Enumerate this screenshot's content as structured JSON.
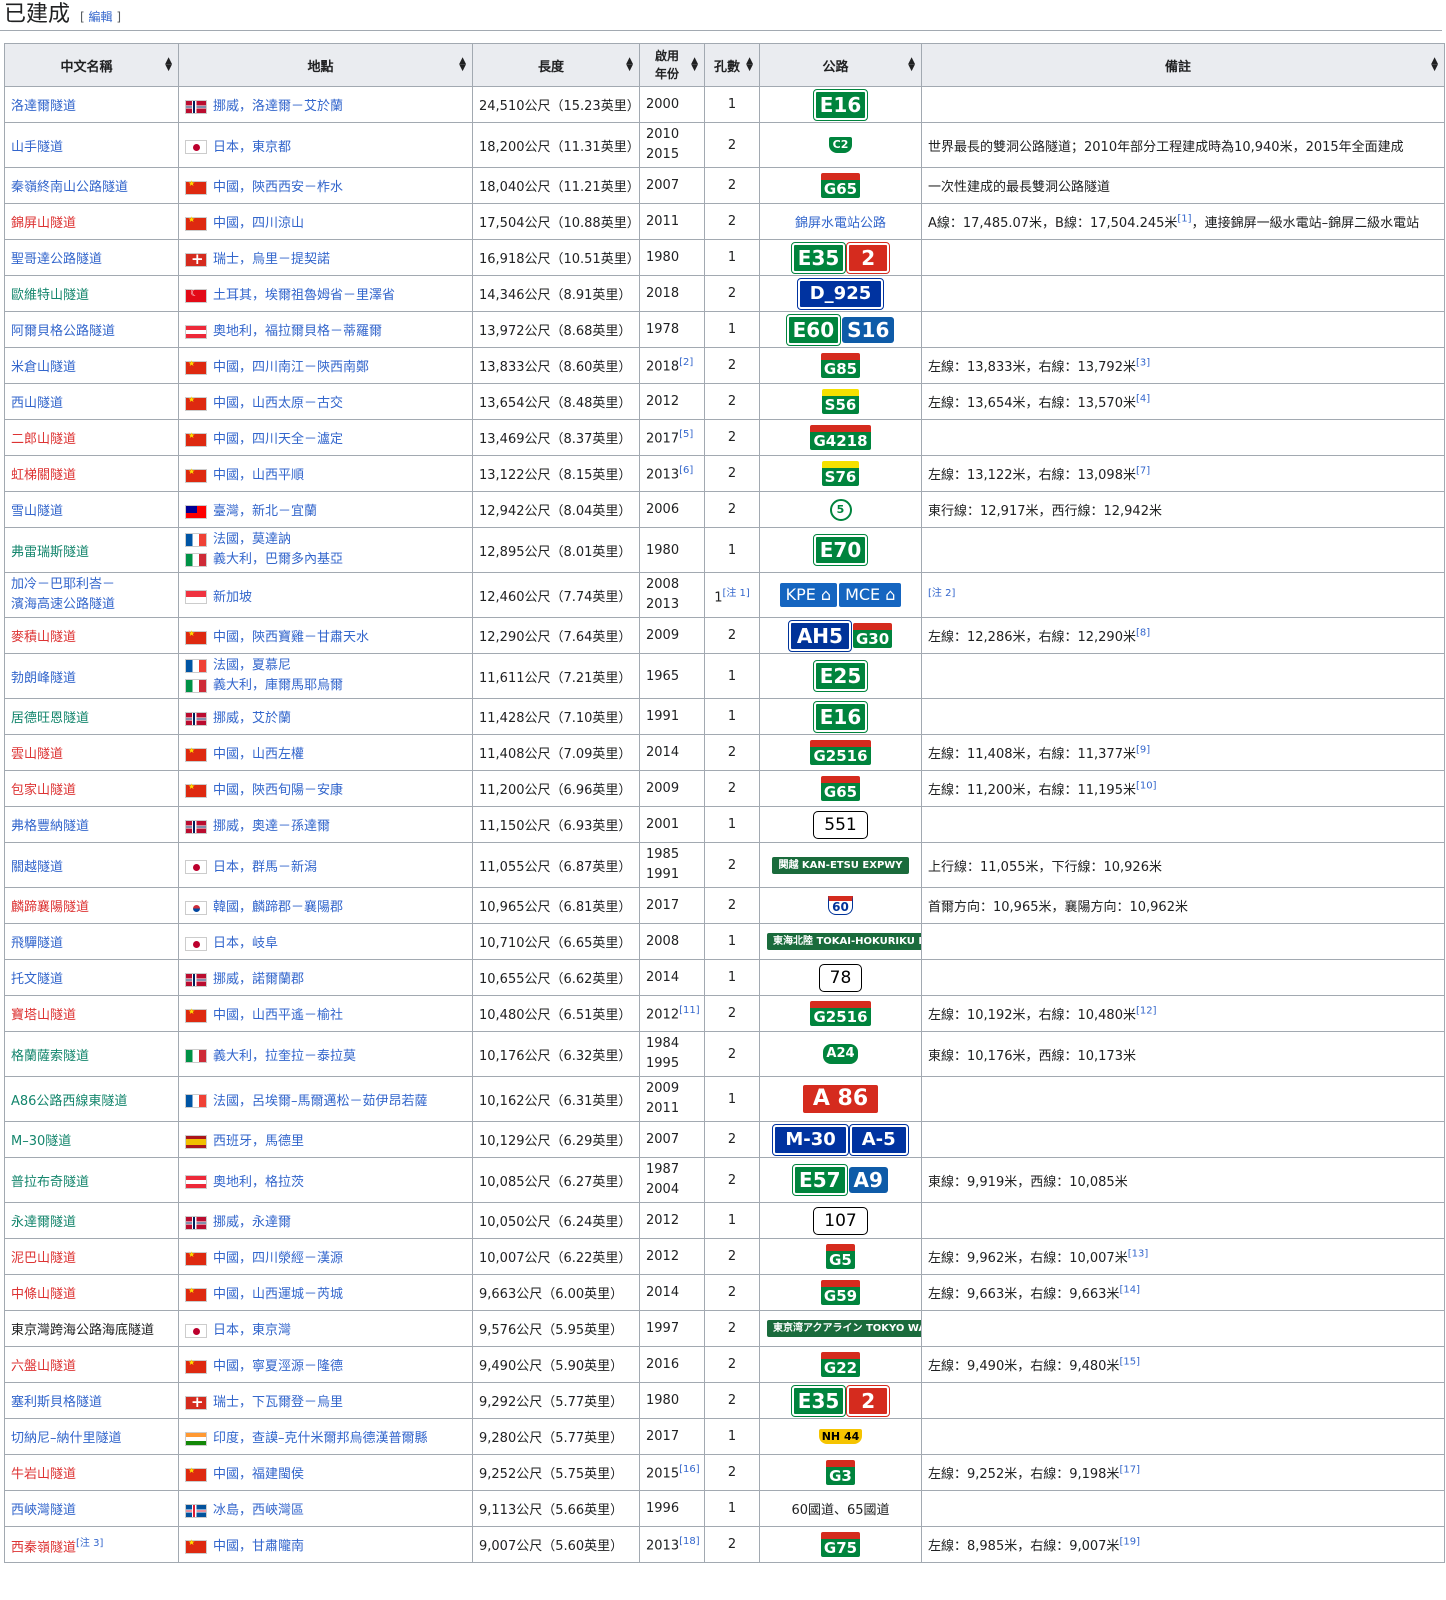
{
  "section": {
    "title": "已建成",
    "edit_open": "[",
    "edit_label": "編輯",
    "edit_close": "]"
  },
  "headers": {
    "name": "中文名稱",
    "location": "地點",
    "length": "長度",
    "year_line1": "啟用",
    "year_line2": "年份",
    "bores": "孔數",
    "road": "公路",
    "notes": "備註"
  },
  "rows": [
    {
      "name": "洛達爾隧道",
      "nc": "lk",
      "flag": "no",
      "loc": "挪威，洛達爾－艾於蘭",
      "len": "24,510公尺（15.23英里）",
      "y1": "2000",
      "y2": "",
      "ysup": "",
      "bores": "1",
      "bsup": "",
      "roads": [
        {
          "t": "E16",
          "k": "r-e"
        }
      ],
      "note": "",
      "nsup": ""
    },
    {
      "name": "山手隧道",
      "nc": "lk",
      "flag": "jp",
      "loc": "日本，東京都",
      "len": "18,200公尺（11.31英里）",
      "y1": "2010",
      "y2": "2015",
      "ysup": "",
      "bores": "2",
      "bsup": "",
      "roads": [
        {
          "t": "C2",
          "k": "r-c2"
        }
      ],
      "note": "世界最長的雙洞公路隧道；2010年部分工程建成時為10,940米，2015年全面建成",
      "nsup": ""
    },
    {
      "name": "秦嶺終南山公路隧道",
      "nc": "lk",
      "flag": "cn",
      "loc": "中國，陝西西安－柞水",
      "len": "18,040公尺（11.21英里）",
      "y1": "2007",
      "y2": "",
      "ysup": "",
      "bores": "2",
      "bsup": "",
      "roads": [
        {
          "t": "G65",
          "k": "r-g"
        }
      ],
      "note": "一次性建成的最長雙洞公路隧道",
      "nsup": ""
    },
    {
      "name": "錦屏山隧道",
      "nc": "lk-r",
      "flag": "cn",
      "loc": "中國，四川涼山",
      "len": "17,504公尺（10.88英里）",
      "y1": "2011",
      "y2": "",
      "ysup": "",
      "bores": "2",
      "bsup": "",
      "roads": [
        {
          "t": "錦屏水電站公路",
          "k": "text"
        }
      ],
      "note": "A線：17,485.07米，B線：17,504.245米",
      "nsup": "[1]",
      "note2": "，連接錦屏一級水電站–錦屏二級水電站"
    },
    {
      "name": "聖哥達公路隧道",
      "nc": "lk",
      "flag": "ch",
      "loc": "瑞士，烏里－提契諾",
      "len": "16,918公尺（10.51英里）",
      "y1": "1980",
      "y2": "",
      "ysup": "",
      "bores": "1",
      "bsup": "",
      "roads": [
        {
          "t": "E35",
          "k": "r-e"
        },
        {
          "t": "2",
          "k": "r-ch"
        }
      ],
      "note": "",
      "nsup": ""
    },
    {
      "name": "歐維特山隧道",
      "nc": "lk-g",
      "flag": "tr",
      "loc": "土耳其，埃爾祖魯姆省－里澤省",
      "len": "14,346公尺（8.91英里）",
      "y1": "2018",
      "y2": "",
      "ysup": "",
      "bores": "2",
      "bsup": "",
      "roads": [
        {
          "t": "D_925",
          "k": "r-blue"
        }
      ],
      "note": "",
      "nsup": ""
    },
    {
      "name": "阿爾貝格公路隧道",
      "nc": "lk",
      "flag": "at",
      "loc": "奧地利，福拉爾貝格－蒂羅爾",
      "len": "13,972公尺（8.68英里）",
      "y1": "1978",
      "y2": "",
      "ysup": "",
      "bores": "1",
      "bsup": "",
      "roads": [
        {
          "t": "E60",
          "k": "r-e"
        },
        {
          "t": "S16",
          "k": "r-at"
        }
      ],
      "note": "",
      "nsup": ""
    },
    {
      "name": "米倉山隧道",
      "nc": "lk",
      "flag": "cn",
      "loc": "中國，四川南江－陝西南鄭",
      "len": "13,833公尺（8.60英里）",
      "y1": "2018",
      "y2": "",
      "ysup": "[2]",
      "bores": "2",
      "bsup": "",
      "roads": [
        {
          "t": "G85",
          "k": "r-g"
        }
      ],
      "note": "左線：13,833米，右線：13,792米",
      "nsup": "[3]"
    },
    {
      "name": "西山隧道",
      "nc": "lk",
      "flag": "cn",
      "loc": "中國，山西太原－古交",
      "len": "13,654公尺（8.48英里）",
      "y1": "2012",
      "y2": "",
      "ysup": "",
      "bores": "2",
      "bsup": "",
      "roads": [
        {
          "t": "S56",
          "k": "r-s"
        }
      ],
      "note": "左線：13,654米，右線：13,570米",
      "nsup": "[4]"
    },
    {
      "name": "二郎山隧道",
      "nc": "lk-r",
      "flag": "cn",
      "loc": "中國，四川天全－瀘定",
      "len": "13,469公尺（8.37英里）",
      "y1": "2017",
      "y2": "",
      "ysup": "[5]",
      "bores": "2",
      "bsup": "",
      "roads": [
        {
          "t": "G4218",
          "k": "r-g"
        }
      ],
      "note": "",
      "nsup": ""
    },
    {
      "name": "虹梯關隧道",
      "nc": "lk-r",
      "flag": "cn",
      "loc": "中國，山西平順",
      "len": "13,122公尺（8.15英里）",
      "y1": "2013",
      "y2": "",
      "ysup": "[6]",
      "bores": "2",
      "bsup": "",
      "roads": [
        {
          "t": "S76",
          "k": "r-s"
        }
      ],
      "note": "左線：13,122米，右線：13,098米",
      "nsup": "[7]"
    },
    {
      "name": "雪山隧道",
      "nc": "lk",
      "flag": "tw",
      "loc": "臺灣，新北－宜蘭",
      "len": "12,942公尺（8.04英里）",
      "y1": "2006",
      "y2": "",
      "ysup": "",
      "bores": "2",
      "bsup": "",
      "roads": [
        {
          "t": "5",
          "k": "r-tw"
        }
      ],
      "note": "東行線：12,917米，西行線：12,942米",
      "nsup": ""
    },
    {
      "name": "弗雷瑞斯隧道",
      "nc": "lk-g",
      "flag": "fr",
      "flag2": "it",
      "loc": "法國，莫達訥",
      "loc2": "義大利，巴爾多內基亞",
      "len": "12,895公尺（8.01英里）",
      "y1": "1980",
      "y2": "",
      "ysup": "",
      "bores": "1",
      "bsup": "",
      "roads": [
        {
          "t": "E70",
          "k": "r-e"
        }
      ],
      "note": "",
      "nsup": ""
    },
    {
      "name": "加冷－巴耶利峇－",
      "name2": "濱海高速公路隧道",
      "nc": "lk",
      "flag": "sg",
      "loc": "新加坡",
      "len": "12,460公尺（7.74英里）",
      "y1": "2008",
      "y2": "2013",
      "ysup": "",
      "bores": "1",
      "bsup": "[注 1]",
      "roads": [
        {
          "t": "KPE ⌂",
          "k": "r-sg"
        },
        {
          "t": "MCE ⌂",
          "k": "r-sg"
        }
      ],
      "note": "",
      "nsup": "[注 2]"
    },
    {
      "name": "麥積山隧道",
      "nc": "lk-r",
      "flag": "cn",
      "loc": "中國，陝西寶雞－甘肅天水",
      "len": "12,290公尺（7.64英里）",
      "y1": "2009",
      "y2": "",
      "ysup": "",
      "bores": "2",
      "bsup": "",
      "roads": [
        {
          "t": "AH5",
          "k": "r-ah"
        },
        {
          "t": "G30",
          "k": "r-g"
        }
      ],
      "note": "左線：12,286米，右線：12,290米",
      "nsup": "[8]"
    },
    {
      "name": "勃朗峰隧道",
      "nc": "lk",
      "flag": "fr",
      "flag2": "it",
      "loc": "法國，夏慕尼",
      "loc2": "義大利，庫爾馬耶烏爾",
      "len": "11,611公尺（7.21英里）",
      "y1": "1965",
      "y2": "",
      "ysup": "",
      "bores": "1",
      "bsup": "",
      "roads": [
        {
          "t": "E25",
          "k": "r-e"
        }
      ],
      "note": "",
      "nsup": ""
    },
    {
      "name": "居德旺恩隧道",
      "nc": "lk-g",
      "flag": "no",
      "loc": "挪威，艾於蘭",
      "len": "11,428公尺（7.10英里）",
      "y1": "1991",
      "y2": "",
      "ysup": "",
      "bores": "1",
      "bsup": "",
      "roads": [
        {
          "t": "E16",
          "k": "r-e"
        }
      ],
      "note": "",
      "nsup": ""
    },
    {
      "name": "雲山隧道",
      "nc": "lk-r",
      "flag": "cn",
      "loc": "中國，山西左權",
      "len": "11,408公尺（7.09英里）",
      "y1": "2014",
      "y2": "",
      "ysup": "",
      "bores": "2",
      "bsup": "",
      "roads": [
        {
          "t": "G2516",
          "k": "r-g"
        }
      ],
      "note": "左線：11,408米，右線：11,377米",
      "nsup": "[9]"
    },
    {
      "name": "包家山隧道",
      "nc": "lk-r",
      "flag": "cn",
      "loc": "中國，陝西旬陽－安康",
      "len": "11,200公尺（6.96英里）",
      "y1": "2009",
      "y2": "",
      "ysup": "",
      "bores": "2",
      "bsup": "",
      "roads": [
        {
          "t": "G65",
          "k": "r-g"
        }
      ],
      "note": "左線：11,200米，右線：11,195米",
      "nsup": "[10]"
    },
    {
      "name": "弗格豐納隧道",
      "nc": "lk",
      "flag": "no",
      "loc": "挪威，奧達－孫達爾",
      "len": "11,150公尺（6.93英里）",
      "y1": "2001",
      "y2": "",
      "ysup": "",
      "bores": "1",
      "bsup": "",
      "roads": [
        {
          "t": "551",
          "k": "r-wh"
        }
      ],
      "note": "",
      "nsup": ""
    },
    {
      "name": "關越隧道",
      "nc": "lk",
      "flag": "jp",
      "loc": "日本，群馬－新潟",
      "len": "11,055公尺（6.87英里）",
      "y1": "1985",
      "y2": "1991",
      "ysup": "",
      "bores": "2",
      "bsup": "",
      "roads": [
        {
          "t": "関越 KAN-ETSU EXPWY",
          "k": "r-jp"
        }
      ],
      "note": "上行線：11,055米，下行線：10,926米",
      "nsup": ""
    },
    {
      "name": "麟蹄襄陽隧道",
      "nc": "lk-r",
      "flag": "kr",
      "loc": "韓國，麟蹄郡－襄陽郡",
      "len": "10,965公尺（6.81英里）",
      "y1": "2017",
      "y2": "",
      "ysup": "",
      "bores": "2",
      "bsup": "",
      "roads": [
        {
          "t": "60",
          "k": "r-kr"
        }
      ],
      "note": "首爾方向：10,965米，襄陽方向：10,962米",
      "nsup": ""
    },
    {
      "name": "飛驒隧道",
      "nc": "lk",
      "flag": "jp",
      "loc": "日本，岐阜",
      "len": "10,710公尺（6.65英里）",
      "y1": "2008",
      "y2": "",
      "ysup": "",
      "bores": "1",
      "bsup": "",
      "roads": [
        {
          "t": "東海北陸 TOKAI-HOKURIKU EXPWY",
          "k": "r-jp"
        }
      ],
      "note": "",
      "nsup": ""
    },
    {
      "name": "托文隧道",
      "nc": "lk",
      "flag": "no",
      "loc": "挪威，諾爾蘭郡",
      "len": "10,655公尺（6.62英里）",
      "y1": "2014",
      "y2": "",
      "ysup": "",
      "bores": "1",
      "bsup": "",
      "roads": [
        {
          "t": "78",
          "k": "r-wh"
        }
      ],
      "note": "",
      "nsup": ""
    },
    {
      "name": "寶塔山隧道",
      "nc": "lk-r",
      "flag": "cn",
      "loc": "中國，山西平遙－榆社",
      "len": "10,480公尺（6.51英里）",
      "y1": "2012",
      "y2": "",
      "ysup": "[11]",
      "bores": "2",
      "bsup": "",
      "roads": [
        {
          "t": "G2516",
          "k": "r-g"
        }
      ],
      "note": "左線：10,192米，右線：10,480米",
      "nsup": "[12]"
    },
    {
      "name": "格蘭薩索隧道",
      "nc": "lk-g",
      "flag": "it",
      "loc": "義大利，拉奎拉－泰拉莫",
      "len": "10,176公尺（6.32英里）",
      "y1": "1984",
      "y2": "1995",
      "ysup": "",
      "bores": "2",
      "bsup": "",
      "roads": [
        {
          "t": "A24",
          "k": "r-it"
        }
      ],
      "note": "東線：10,176米，西線：10,173米",
      "nsup": ""
    },
    {
      "name": "A86公路西線東隧道",
      "nc": "lk-g",
      "flag": "fr",
      "loc": "法國，呂埃爾–馬爾邁松－茹伊昂若薩",
      "len": "10,162公尺（6.31英里）",
      "y1": "2009",
      "y2": "2011",
      "ysup": "",
      "bores": "1",
      "bsup": "",
      "roads": [
        {
          "t": "A 86",
          "k": "r-fr"
        }
      ],
      "note": "",
      "nsup": ""
    },
    {
      "name": "M–30隧道",
      "nc": "lk-g",
      "flag": "es",
      "loc": "西班牙，馬德里",
      "len": "10,129公尺（6.29英里）",
      "y1": "2007",
      "y2": "",
      "ysup": "",
      "bores": "2",
      "bsup": "",
      "roads": [
        {
          "t": "M-30",
          "k": "r-blue"
        },
        {
          "t": "A-5",
          "k": "r-blue"
        }
      ],
      "note": "",
      "nsup": ""
    },
    {
      "name": "普拉布奇隧道",
      "nc": "lk-g",
      "flag": "at",
      "loc": "奧地利，格拉茨",
      "len": "10,085公尺（6.27英里）",
      "y1": "1987",
      "y2": "2004",
      "ysup": "",
      "bores": "2",
      "bsup": "",
      "roads": [
        {
          "t": "E57",
          "k": "r-e"
        },
        {
          "t": "A9",
          "k": "r-at"
        }
      ],
      "note": "東線：9,919米，西線：10,085米",
      "nsup": ""
    },
    {
      "name": "永達爾隧道",
      "nc": "lk-g",
      "flag": "no",
      "loc": "挪威，永達爾",
      "len": "10,050公尺（6.24英里）",
      "y1": "2012",
      "y2": "",
      "ysup": "",
      "bores": "1",
      "bsup": "",
      "roads": [
        {
          "t": "107",
          "k": "r-wh"
        }
      ],
      "note": "",
      "nsup": ""
    },
    {
      "name": "泥巴山隧道",
      "nc": "lk-r",
      "flag": "cn",
      "loc": "中國，四川滎經－漢源",
      "len": "10,007公尺（6.22英里）",
      "y1": "2012",
      "y2": "",
      "ysup": "",
      "bores": "2",
      "bsup": "",
      "roads": [
        {
          "t": "G5",
          "k": "r-g"
        }
      ],
      "note": "左線：9,962米，右線：10,007米",
      "nsup": "[13]"
    },
    {
      "name": "中條山隧道",
      "nc": "lk-r",
      "flag": "cn",
      "loc": "中國，山西運城－芮城",
      "len": "9,663公尺（6.00英里）",
      "y1": "2014",
      "y2": "",
      "ysup": "",
      "bores": "2",
      "bsup": "",
      "roads": [
        {
          "t": "G59",
          "k": "r-g"
        }
      ],
      "note": "左線：9,663米，右線：9,663米",
      "nsup": "[14]"
    },
    {
      "name": "東京灣跨海公路海底隧道",
      "nc": "",
      "flag": "jp",
      "loc": "日本，東京灣",
      "len": "9,576公尺（5.95英里）",
      "y1": "1997",
      "y2": "",
      "ysup": "",
      "bores": "2",
      "bsup": "",
      "roads": [
        {
          "t": "東京湾アクアライン TOKYO WAN AQUA-LINE EXPWY",
          "k": "r-jp"
        }
      ],
      "note": "",
      "nsup": ""
    },
    {
      "name": "六盤山隧道",
      "nc": "lk-r",
      "flag": "cn",
      "loc": "中國，寧夏涇源－隆德",
      "len": "9,490公尺（5.90英里）",
      "y1": "2016",
      "y2": "",
      "ysup": "",
      "bores": "2",
      "bsup": "",
      "roads": [
        {
          "t": "G22",
          "k": "r-g"
        }
      ],
      "note": "左線：9,490米，右線：9,480米",
      "nsup": "[15]"
    },
    {
      "name": "塞利斯貝格隧道",
      "nc": "lk",
      "flag": "ch",
      "loc": "瑞士，下瓦爾登－烏里",
      "len": "9,292公尺（5.77英里）",
      "y1": "1980",
      "y2": "",
      "ysup": "",
      "bores": "2",
      "bsup": "",
      "roads": [
        {
          "t": "E35",
          "k": "r-e"
        },
        {
          "t": "2",
          "k": "r-ch"
        }
      ],
      "note": "",
      "nsup": ""
    },
    {
      "name": "切納尼–納什里隧道",
      "nc": "lk",
      "flag": "in",
      "loc": "印度，查謨–克什米爾邦烏德漢普爾縣",
      "len": "9,280公尺（5.77英里）",
      "y1": "2017",
      "y2": "",
      "ysup": "",
      "bores": "1",
      "bsup": "",
      "roads": [
        {
          "t": "NH 44",
          "k": "r-in"
        }
      ],
      "note": "",
      "nsup": ""
    },
    {
      "name": "牛岩山隧道",
      "nc": "lk-r",
      "flag": "cn",
      "loc": "中國，福建閩侯",
      "len": "9,252公尺（5.75英里）",
      "y1": "2015",
      "y2": "",
      "ysup": "[16]",
      "bores": "2",
      "bsup": "",
      "roads": [
        {
          "t": "G3",
          "k": "r-g"
        }
      ],
      "note": "左線：9,252米，右線：9,198米",
      "nsup": "[17]"
    },
    {
      "name": "西峽灣隧道",
      "nc": "lk",
      "flag": "is",
      "loc": "冰島，西峽灣區",
      "len": "9,113公尺（5.66英里）",
      "y1": "1996",
      "y2": "",
      "ysup": "",
      "bores": "1",
      "bsup": "",
      "roads": [
        {
          "t": "60國道、65國道",
          "k": "text"
        }
      ],
      "note": "",
      "nsup": ""
    },
    {
      "name": "西秦嶺隧道",
      "nc": "lk-r",
      "nsup_name": "[注 3]",
      "flag": "cn",
      "loc": "中國，甘肅隴南",
      "len": "9,007公尺（5.60英里）",
      "y1": "2013",
      "y2": "",
      "ysup": "[18]",
      "bores": "2",
      "bsup": "",
      "roads": [
        {
          "t": "G75",
          "k": "r-g"
        }
      ],
      "note": "左線：8,985米，右線：9,007米",
      "nsup": "[19]"
    }
  ]
}
